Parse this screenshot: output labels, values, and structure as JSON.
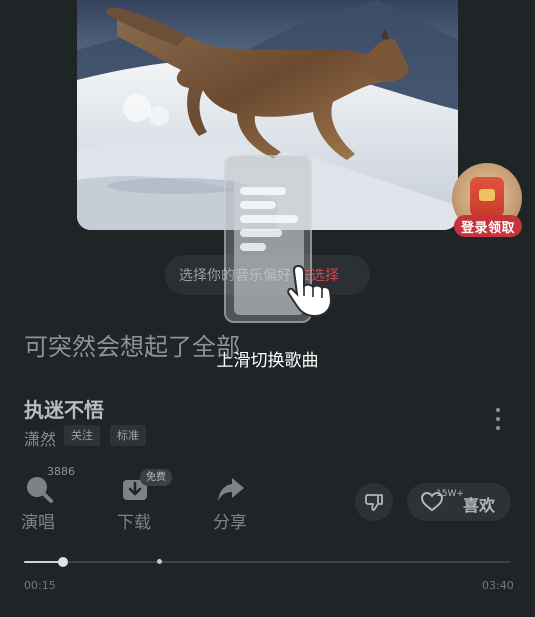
{
  "promo": {
    "label": "登录领取",
    "icon": "red-packet-icon"
  },
  "preference": {
    "text": "选择你的音乐偏好",
    "action": "去选择"
  },
  "lyric": {
    "current": "可突然会想起了全部"
  },
  "guide": {
    "hint": "上滑切换歌曲",
    "icon": "swipe-up-hand-icon"
  },
  "song": {
    "title": "执迷不悟",
    "artist": "潇然",
    "follow_tag": "关注",
    "quality_tag": "标准"
  },
  "actions": {
    "sing": {
      "label": "演唱",
      "count": "3886",
      "icon": "microphone-icon"
    },
    "download": {
      "label": "下载",
      "badge": "免费",
      "icon": "download-icon"
    },
    "share": {
      "label": "分享",
      "icon": "share-icon"
    }
  },
  "like": {
    "count": "15W+",
    "label": "喜欢",
    "icon": "heart-outline-icon"
  },
  "dislike": {
    "icon": "thumbs-down-icon"
  },
  "progress": {
    "elapsed": "00:15",
    "total": "03:40",
    "fraction": 0.08,
    "marker_fraction": 0.278
  },
  "colors": {
    "background": "#1f2427",
    "accent": "#d3484d",
    "promo_red": "#c8323a"
  }
}
